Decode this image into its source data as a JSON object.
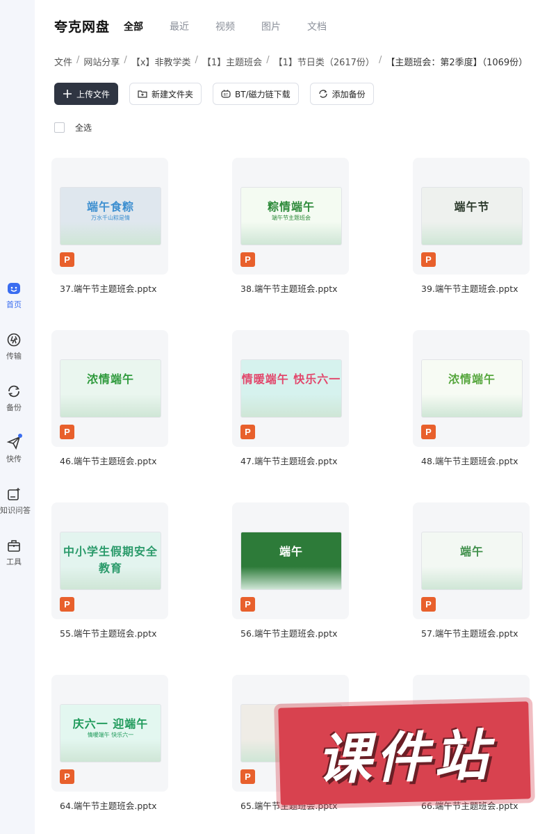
{
  "brand": "夸克网盘",
  "tabs": [
    {
      "label": "全部",
      "active": true
    },
    {
      "label": "最近",
      "active": false
    },
    {
      "label": "视频",
      "active": false
    },
    {
      "label": "图片",
      "active": false
    },
    {
      "label": "文档",
      "active": false
    }
  ],
  "breadcrumb": [
    "文件",
    "网站分享",
    "【x】非教学类",
    "【1】主题班会",
    "【1】节日类（2617份）",
    "【主题班会：第2季度】（1069份）"
  ],
  "toolbar": {
    "upload": "上传文件",
    "new_folder": "新建文件夹",
    "bt": "BT/磁力链下载",
    "backup": "添加备份"
  },
  "select_all": "全选",
  "sidebar": [
    {
      "label": "首页",
      "icon": "home-face-icon",
      "active": true
    },
    {
      "label": "传输",
      "icon": "transfer-icon",
      "active": false
    },
    {
      "label": "备份",
      "icon": "backup-icon",
      "active": false
    },
    {
      "label": "快传",
      "icon": "quick-send-icon",
      "active": false
    },
    {
      "label": "知识问答",
      "icon": "qa-icon",
      "active": false
    },
    {
      "label": "工具",
      "icon": "toolbox-icon",
      "active": false
    }
  ],
  "files": [
    {
      "name": "37.端午节主题班会.pptx",
      "thumb_title": "端午食粽",
      "thumb_sub": "万水千山粽是情",
      "theme": "#dfe7ee",
      "accent": "#3d8fd0"
    },
    {
      "name": "38.端午节主题班会.pptx",
      "thumb_title": "粽情端午",
      "thumb_sub": "端午节主题班会",
      "theme": "#f4fbf2",
      "accent": "#2d8a3a"
    },
    {
      "name": "39.端午节主题班会.pptx",
      "thumb_title": "端午节",
      "thumb_sub": "",
      "theme": "#eef1ee",
      "accent": "#2c3a2c"
    },
    {
      "name": "46.端午节主题班会.pptx",
      "thumb_title": "浓情端午",
      "thumb_sub": "",
      "theme": "#eaf6ef",
      "accent": "#2e9a3c"
    },
    {
      "name": "47.端午节主题班会.pptx",
      "thumb_title": "情暖端午 快乐六一",
      "thumb_sub": "",
      "theme": "#d6f2ee",
      "accent": "#e2466b"
    },
    {
      "name": "48.端午节主题班会.pptx",
      "thumb_title": "浓情端午",
      "thumb_sub": "",
      "theme": "#f7fbf4",
      "accent": "#56a63d"
    },
    {
      "name": "55.端午节主题班会.pptx",
      "thumb_title": "中小学生假期安全教育",
      "thumb_sub": "",
      "theme": "#e3f4ef",
      "accent": "#2a9a6a"
    },
    {
      "name": "56.端午节主题班会.pptx",
      "thumb_title": "端午",
      "thumb_sub": "",
      "theme": "#2d7b39",
      "accent": "#ffffff"
    },
    {
      "name": "57.端午节主题班会.pptx",
      "thumb_title": "端午",
      "thumb_sub": "",
      "theme": "#f3f8f3",
      "accent": "#3f8f4a"
    },
    {
      "name": "64.端午节主题班会.pptx",
      "thumb_title": "庆六一 迎端午",
      "thumb_sub": "情暖端午 快乐六一",
      "theme": "#e3f7f0",
      "accent": "#1e9a5a"
    },
    {
      "name": "65.端午节主题班会.pptx",
      "thumb_title": "端午",
      "thumb_sub": "",
      "theme": "#efece6",
      "accent": "#444444"
    },
    {
      "name": "66.端午节主题班会.pptx",
      "thumb_title": "浓情端午",
      "thumb_sub": "",
      "theme": "#f3f7ef",
      "accent": "#4c8b2f"
    }
  ],
  "watermark": "课件站"
}
